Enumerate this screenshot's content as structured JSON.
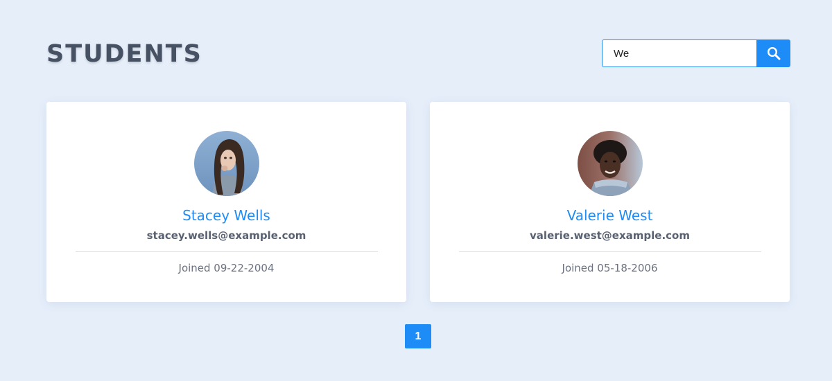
{
  "header": {
    "title": "STUDENTS"
  },
  "search": {
    "value": "We",
    "icon": "search-icon",
    "button_color": "#1e8cf7"
  },
  "students": [
    {
      "name": "Stacey Wells",
      "email": "stacey.wells@example.com",
      "joined": "Joined 09-22-2004",
      "avatar": "avatar-photo"
    },
    {
      "name": "Valerie West",
      "email": "valerie.west@example.com",
      "joined": "Joined 05-18-2006",
      "avatar": "avatar-photo"
    }
  ],
  "pagination": {
    "current_page": "1"
  },
  "colors": {
    "background": "#e6eefa",
    "accent": "#1e8cf7",
    "title": "#465163"
  }
}
